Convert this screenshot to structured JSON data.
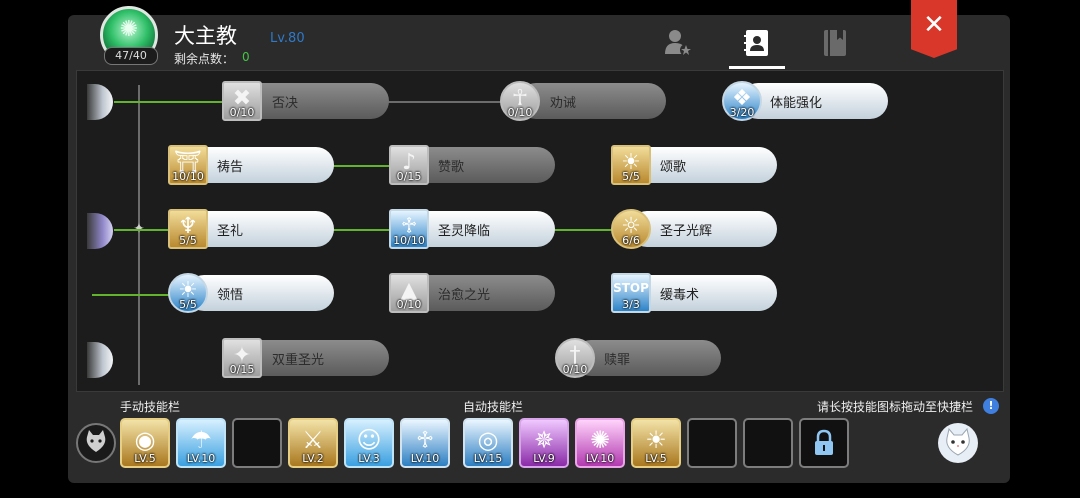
{
  "header": {
    "class_name": "大主教",
    "level": "Lv.80",
    "points_label": "剩余点数：",
    "points_value": "0",
    "portrait_count": "47/40",
    "close_label": "✕",
    "tabs": [
      {
        "icon": "person-star-icon",
        "active": false
      },
      {
        "icon": "contact-book-icon",
        "active": true
      },
      {
        "icon": "book-icon",
        "active": false
      }
    ]
  },
  "skills": [
    {
      "name": "否决",
      "count": "0/10",
      "unlocked": false,
      "icon": "cancel-x-icon"
    },
    {
      "name": "劝诫",
      "count": "0/10",
      "unlocked": false,
      "icon": "kneeling-figure-icon"
    },
    {
      "name": "体能强化",
      "count": "3/20",
      "unlocked": true,
      "icon": "water-drop-icon"
    },
    {
      "name": "祷告",
      "count": "10/10",
      "unlocked": true,
      "icon": "prayer-arch-icon"
    },
    {
      "name": "赞歌",
      "count": "0/15",
      "unlocked": false,
      "icon": "music-note-icon"
    },
    {
      "name": "颂歌",
      "count": "5/5",
      "unlocked": true,
      "icon": "sun-crowd-icon"
    },
    {
      "name": "圣礼",
      "count": "5/5",
      "unlocked": true,
      "icon": "raised-arms-icon"
    },
    {
      "name": "圣灵降临",
      "count": "10/10",
      "unlocked": true,
      "icon": "winged-figure-icon"
    },
    {
      "name": "圣子光辉",
      "count": "6/6",
      "unlocked": true,
      "icon": "halo-child-icon"
    },
    {
      "name": "领悟",
      "count": "5/5",
      "unlocked": true,
      "icon": "lightbulb-icon"
    },
    {
      "name": "治愈之光",
      "count": "0/10",
      "unlocked": false,
      "icon": "light-beam-icon"
    },
    {
      "name": "缓毒术",
      "count": "3/3",
      "unlocked": true,
      "icon": "stop-sign-icon"
    },
    {
      "name": "双重圣光",
      "count": "0/15",
      "unlocked": false,
      "icon": "sparkle-icon"
    },
    {
      "name": "赎罪",
      "count": "0/10",
      "unlocked": false,
      "icon": "sword-icon"
    }
  ],
  "bars": {
    "manual_label": "手动技能栏",
    "auto_label": "自动技能栏",
    "hint": "请长按技能图标拖动至快捷栏",
    "hint_icon": "!",
    "manual_slots": [
      {
        "level": "LV.5",
        "icon": "golden-circle-icon"
      },
      {
        "level": "LV.10",
        "icon": "blue-rain-icon"
      },
      {
        "level": "",
        "icon": ""
      },
      {
        "level": "LV.2",
        "icon": "crossed-swords-icon"
      },
      {
        "level": "LV.3",
        "icon": "angel-halo-icon"
      },
      {
        "level": "LV.10",
        "icon": "winged-figure-icon"
      }
    ],
    "auto_slots": [
      {
        "level": "LV.15",
        "icon": "target-icon"
      },
      {
        "level": "LV.9",
        "icon": "purple-wings-icon"
      },
      {
        "level": "LV.10",
        "icon": "pink-burst-icon"
      },
      {
        "level": "LV.5",
        "icon": "sun-crowd-icon"
      },
      {
        "level": "",
        "icon": ""
      },
      {
        "level": "",
        "icon": ""
      },
      {
        "level": "",
        "icon": "lock-icon"
      }
    ]
  }
}
